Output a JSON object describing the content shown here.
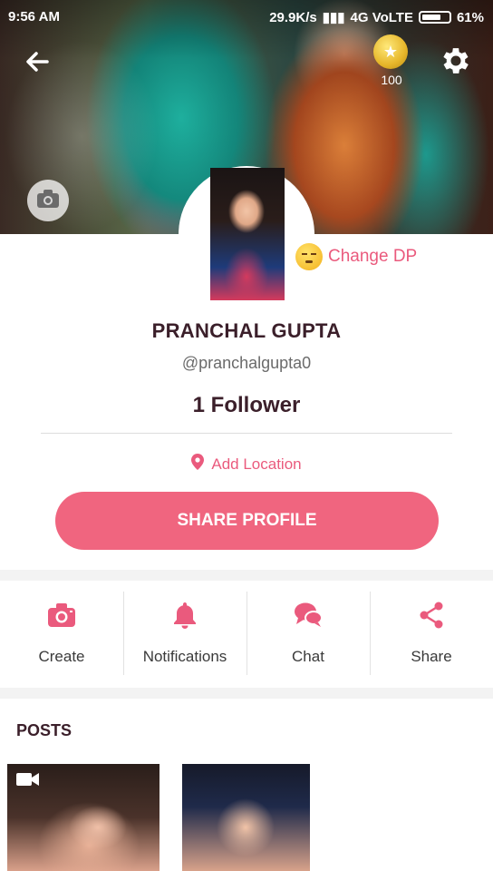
{
  "status_bar": {
    "time": "9:56 AM",
    "network_speed": "29.9K/s",
    "network_type": "4G VoLTE",
    "battery": "61%"
  },
  "header": {
    "coin_count": "100"
  },
  "profile": {
    "change_dp_label": "Change DP",
    "name": "PRANCHAL GUPTA",
    "handle": "@pranchalgupta0",
    "followers": "1 Follower",
    "location_label": "Add Location",
    "share_button_label": "SHARE PROFILE"
  },
  "actions": [
    {
      "label": "Create",
      "icon": "camera-icon"
    },
    {
      "label": "Notifications",
      "icon": "bell-icon"
    },
    {
      "label": "Chat",
      "icon": "chat-icon"
    },
    {
      "label": "Share",
      "icon": "share-icon"
    }
  ],
  "posts": {
    "title": "POSTS"
  },
  "colors": {
    "accent": "#f0657f",
    "accent_text": "#ea5a7d",
    "title_text": "#3b1f2a"
  }
}
